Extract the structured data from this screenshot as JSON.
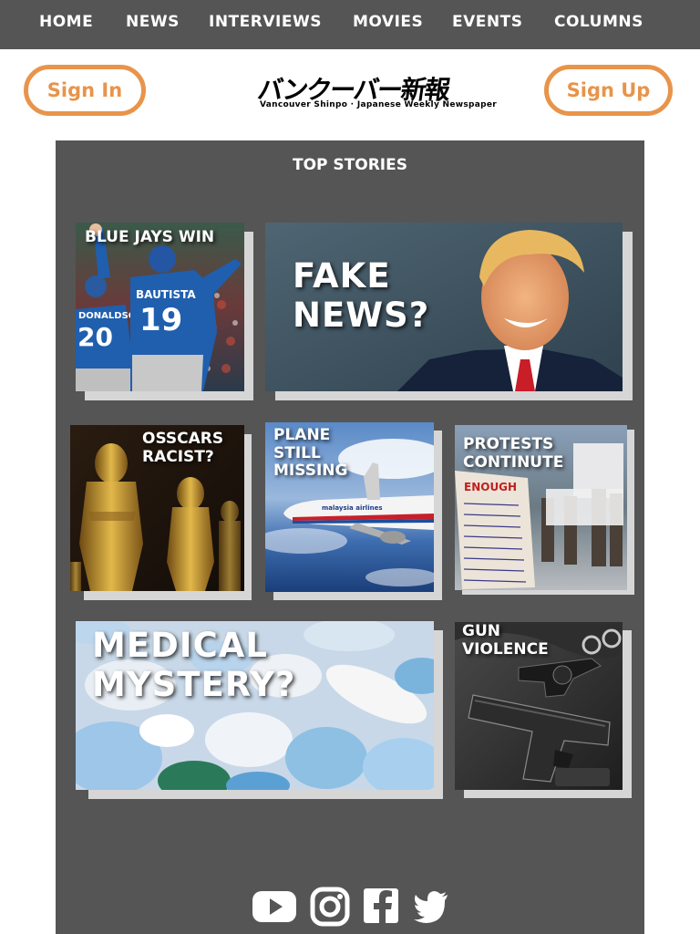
{
  "nav": {
    "items": [
      {
        "label": "HOME"
      },
      {
        "label": "NEWS"
      },
      {
        "label": "INTERVIEWS"
      },
      {
        "label": "MOVIES"
      },
      {
        "label": "EVENTS"
      },
      {
        "label": "COLUMNS"
      }
    ]
  },
  "header": {
    "sign_in": "Sign In",
    "sign_up": "Sign Up",
    "logo_text": "バンクーバー新報",
    "logo_subtext": "Vancouver Shinpo · Japanese Weekly Newspaper"
  },
  "top_stories": {
    "title": "TOP STORIES",
    "stories": [
      {
        "label": "BLUE JAYS WIN",
        "jersey_name": "BAUTISTA",
        "jersey_number": "19",
        "jersey_name_2": "DONALDSON",
        "jersey_number_2": "20"
      },
      {
        "label": "FAKE\nNEWS?"
      },
      {
        "label": "OSSCARS\nRACIST?"
      },
      {
        "label": "PLANE\nSTILL\nMISSING",
        "airline_text": "malaysia airlines"
      },
      {
        "label": "PROTESTS\nCONTINUTE",
        "sign_text": "ENOUGH"
      },
      {
        "label": "MEDICAL\nMYSTERY?"
      },
      {
        "label": "GUN\nVIOLENCE"
      }
    ]
  },
  "social": {
    "icons": [
      "youtube-icon",
      "instagram-icon",
      "facebook-icon",
      "twitter-icon"
    ]
  },
  "colors": {
    "nav_bg": "#555555",
    "accent": "#e8944a",
    "panel_bg": "#555555",
    "card_shadow": "#d6d6d6"
  }
}
